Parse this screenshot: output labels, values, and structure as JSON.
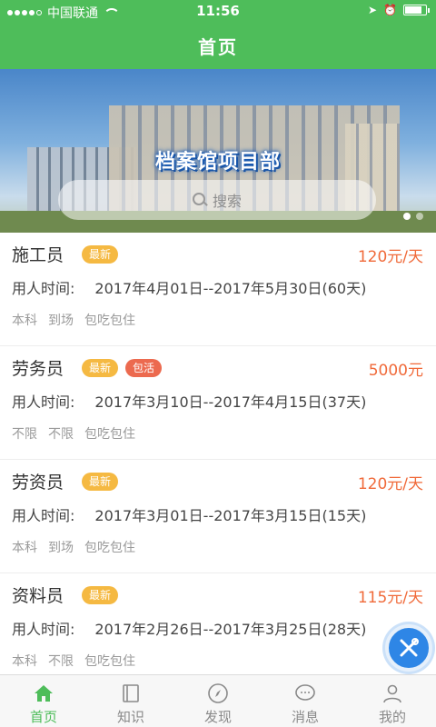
{
  "status_bar": {
    "carrier": "中国联通",
    "time": "11:56"
  },
  "header": {
    "title": "首页"
  },
  "banner": {
    "title": "档案馆项目部",
    "search_placeholder": "搜索",
    "page_count": 2,
    "active_page": 0
  },
  "jobs": [
    {
      "name": "施工员",
      "badges": [
        "最新"
      ],
      "price": "120元/天",
      "period_label": "用人时间:",
      "period": "2017年4月01日--2017年5月30日(60天)",
      "tags": [
        "本科",
        "到场",
        "包吃包住"
      ]
    },
    {
      "name": "劳务员",
      "badges": [
        "最新",
        "包活"
      ],
      "price": "5000元",
      "period_label": "用人时间:",
      "period": "2017年3月10日--2017年4月15日(37天)",
      "tags": [
        "不限",
        "不限",
        "包吃包住"
      ]
    },
    {
      "name": "劳资员",
      "badges": [
        "最新"
      ],
      "price": "120元/天",
      "period_label": "用人时间:",
      "period": "2017年3月01日--2017年3月15日(15天)",
      "tags": [
        "本科",
        "到场",
        "包吃包住"
      ]
    },
    {
      "name": "资料员",
      "badges": [
        "最新"
      ],
      "price": "115元/天",
      "period_label": "用人时间:",
      "period": "2017年2月26日--2017年3月25日(28天)",
      "tags": [
        "本科",
        "不限",
        "包吃包住"
      ]
    }
  ],
  "tabbar": {
    "items": [
      {
        "label": "首页",
        "icon": "home-icon",
        "active": true
      },
      {
        "label": "知识",
        "icon": "book-icon",
        "active": false
      },
      {
        "label": "发现",
        "icon": "compass-icon",
        "active": false
      },
      {
        "label": "消息",
        "icon": "chat-icon",
        "active": false
      },
      {
        "label": "我的",
        "icon": "user-icon",
        "active": false
      }
    ]
  },
  "colors": {
    "brand": "#4ebd5a",
    "price": "#f06a3a",
    "badge_new": "#f5b942",
    "badge_alt": "#ec6a4f",
    "fab": "#2e86e6"
  }
}
